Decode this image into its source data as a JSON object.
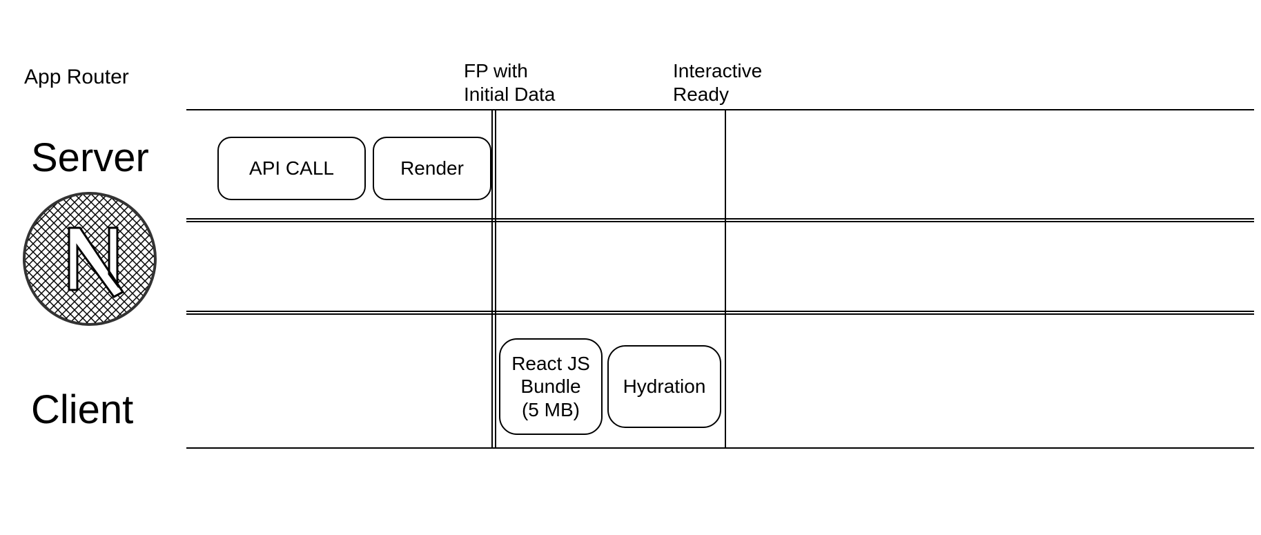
{
  "title": "App Router",
  "labels": {
    "server": "Server",
    "client": "Client"
  },
  "markers": {
    "fp": "FP with\nInitial Data",
    "interactive": "Interactive\n Ready"
  },
  "boxes": {
    "api_call": "API CALL",
    "render": "Render",
    "react_bundle": "React JS\nBundle\n(5 MB)",
    "hydration": "Hydration"
  },
  "chart_data": {
    "type": "table",
    "description": "Timeline diagram showing server/client phases during App Router rendering",
    "rows": [
      "Server",
      "(gap)",
      "Client"
    ],
    "vertical_markers": [
      "FP with Initial Data",
      "Interactive Ready"
    ],
    "server_phase_boxes": [
      "API CALL",
      "Render"
    ],
    "client_phase_boxes": [
      "React JS Bundle (5 MB)",
      "Hydration"
    ]
  }
}
